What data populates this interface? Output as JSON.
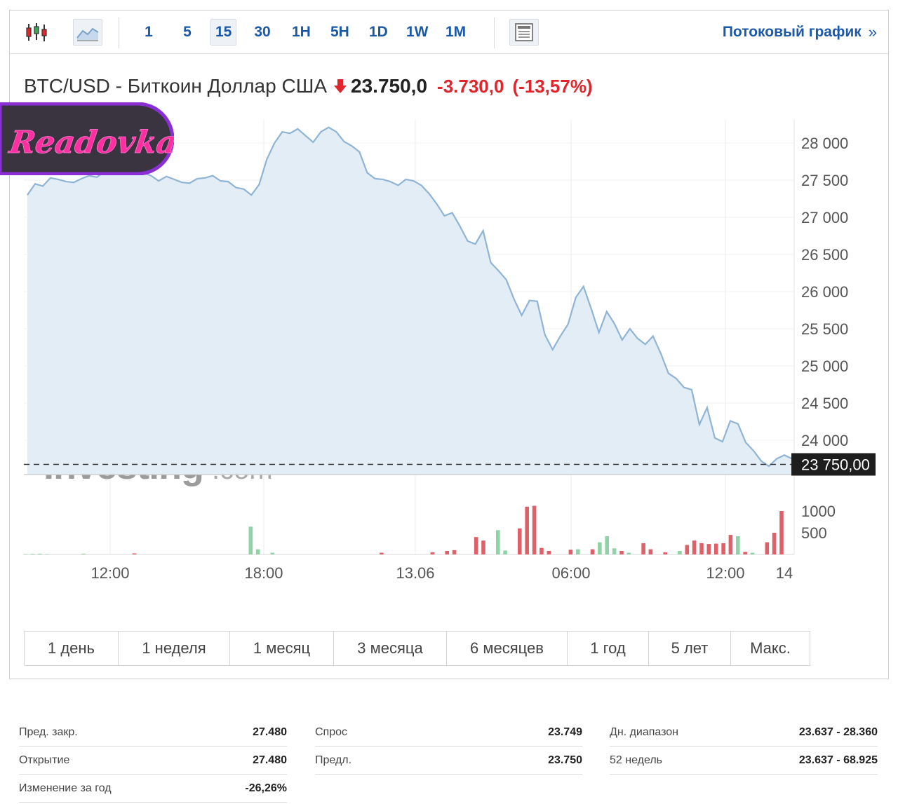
{
  "toolbar": {
    "timeframes": [
      "1",
      "5",
      "15",
      "30",
      "1H",
      "5H",
      "1D",
      "1W",
      "1M"
    ],
    "active_timeframe": "15",
    "streaming_label": "Потоковый график",
    "streaming_chevron": "»",
    "icons": [
      "candlestick-chart-icon",
      "area-chart-icon",
      "chart-settings-icon"
    ]
  },
  "instrument": {
    "name": "BTC/USD - Биткоин Доллар США",
    "direction": "down",
    "price": "23.750,0",
    "change": "-3.730,0",
    "change_pct": "(-13,57%)",
    "down_color": "#e0262c"
  },
  "chart_data": {
    "type": "area",
    "y_ticks": [
      "28 000",
      "27 500",
      "27 000",
      "26 500",
      "26 000",
      "25 500",
      "25 000",
      "24 500",
      "24 000"
    ],
    "y_tick_values": [
      28000,
      27500,
      27000,
      26500,
      26000,
      25500,
      25000,
      24500,
      24000
    ],
    "ylim": [
      23650,
      28350
    ],
    "x_ticks": [
      "12:00",
      "18:00",
      "13.06",
      "06:00",
      "12:00",
      "14"
    ],
    "x_tick_index": [
      11,
      31,
      51,
      71,
      91,
      99
    ],
    "current_price_label": "23 750,00",
    "current_price": 23750,
    "volume_ticks": [
      "1000",
      "500"
    ],
    "volume_tick_values": [
      1000,
      500
    ],
    "volume_max": 1300,
    "watermark": "Investing.com",
    "line_color": "#8fb4d6",
    "fill_color": "#e3edf5",
    "up_color": "#8fd3a6",
    "down_bar_color": "#e0606a",
    "values": [
      27300,
      27450,
      27420,
      27530,
      27510,
      27480,
      27470,
      27520,
      27560,
      27540,
      27620,
      27700,
      27680,
      27640,
      27590,
      27600,
      27560,
      27490,
      27550,
      27510,
      27470,
      27460,
      27520,
      27530,
      27560,
      27490,
      27480,
      27400,
      27380,
      27300,
      27440,
      27780,
      28000,
      28150,
      28130,
      28190,
      28100,
      28010,
      28150,
      28210,
      28150,
      28020,
      27960,
      27880,
      27600,
      27520,
      27510,
      27480,
      27430,
      27510,
      27490,
      27430,
      27320,
      27180,
      27020,
      27060,
      26880,
      26680,
      26640,
      26820,
      26390,
      26280,
      26160,
      25900,
      25680,
      25880,
      25870,
      25420,
      25220,
      25400,
      25560,
      25920,
      26070,
      25770,
      25450,
      25730,
      25570,
      25350,
      25500,
      25370,
      25290,
      25400,
      25170,
      24900,
      24830,
      24710,
      24680,
      24210,
      24440,
      24030,
      23980,
      24260,
      24220,
      23970,
      23860,
      23720,
      23650,
      23750,
      23800,
      23750
    ],
    "volumes": [
      10,
      15,
      20,
      10,
      0,
      0,
      0,
      0,
      20,
      0,
      0,
      0,
      0,
      0,
      0,
      25,
      0,
      0,
      0,
      0,
      0,
      0,
      0,
      0,
      0,
      0,
      0,
      0,
      0,
      0,
      0,
      640,
      120,
      0,
      40,
      0,
      0,
      0,
      0,
      0,
      0,
      0,
      0,
      0,
      0,
      0,
      0,
      0,
      0,
      40,
      0,
      0,
      0,
      0,
      0,
      0,
      50,
      0,
      80,
      100,
      0,
      0,
      400,
      320,
      0,
      560,
      90,
      0,
      600,
      1100,
      1120,
      150,
      80,
      0,
      0,
      110,
      120,
      0,
      120,
      280,
      420,
      140,
      80,
      40,
      0,
      260,
      120,
      0,
      50,
      0,
      80,
      220,
      320,
      260,
      240,
      250,
      260,
      450,
      420,
      60,
      40,
      0,
      280,
      500,
      1000
    ],
    "volume_dir": [
      "u",
      "u",
      "u",
      "u",
      "u",
      "u",
      "u",
      "u",
      "u",
      "u",
      "u",
      "u",
      "u",
      "u",
      "u",
      "d",
      "u",
      "u",
      "u",
      "u",
      "u",
      "u",
      "u",
      "u",
      "u",
      "u",
      "u",
      "u",
      "u",
      "u",
      "u",
      "u",
      "u",
      "u",
      "u",
      "u",
      "u",
      "u",
      "u",
      "u",
      "u",
      "u",
      "u",
      "u",
      "u",
      "u",
      "u",
      "u",
      "u",
      "d",
      "u",
      "u",
      "u",
      "u",
      "u",
      "u",
      "d",
      "u",
      "d",
      "d",
      "u",
      "u",
      "d",
      "d",
      "u",
      "u",
      "u",
      "u",
      "d",
      "d",
      "d",
      "d",
      "d",
      "u",
      "u",
      "d",
      "u",
      "u",
      "d",
      "u",
      "u",
      "u",
      "d",
      "u",
      "u",
      "d",
      "d",
      "u",
      "d",
      "u",
      "u",
      "d",
      "d",
      "d",
      "d",
      "d",
      "d",
      "d",
      "u",
      "d",
      "u",
      "d",
      "d",
      "d",
      "d"
    ]
  },
  "ranges": [
    "1 день",
    "1 неделя",
    "1 месяц",
    "3 месяца",
    "6 месяцев",
    "1 год",
    "5 лет",
    "Макс."
  ],
  "stats": {
    "col1": [
      {
        "label": "Пред. закр.",
        "value": "27.480"
      },
      {
        "label": "Открытие",
        "value": "27.480"
      },
      {
        "label": "Изменение за год",
        "value": "-26,26%"
      }
    ],
    "col2": [
      {
        "label": "Спрос",
        "value": "23.749"
      },
      {
        "label": "Предл.",
        "value": "23.750"
      }
    ],
    "col3": [
      {
        "label": "Дн. диапазон",
        "value": "23.637 - 28.360"
      },
      {
        "label": "52 недель",
        "value": "23.637 - 68.925"
      }
    ]
  },
  "overlay_logo": {
    "text": "Readovka",
    "bg_color": "#3a3340",
    "ring_color": "#8a2fd6",
    "text_color": "#ff2fa0"
  }
}
